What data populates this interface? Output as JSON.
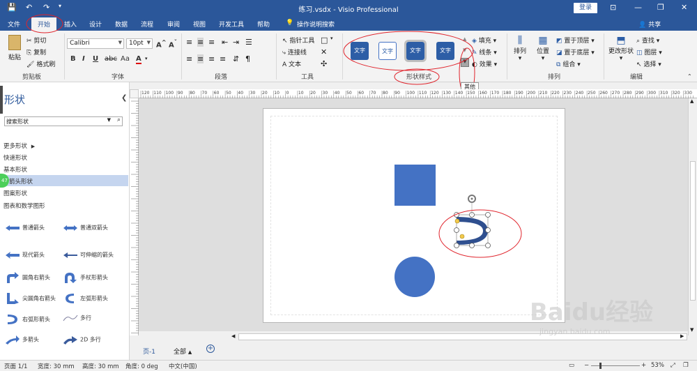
{
  "window": {
    "title": "练习.vsdx - Visio Professional",
    "login_label": "登录"
  },
  "tabs": [
    "文件",
    "开始",
    "插入",
    "设计",
    "数据",
    "流程",
    "审阅",
    "视图",
    "开发工具",
    "帮助",
    "操作说明搜索"
  ],
  "share_label": "共享",
  "ribbon": {
    "clipboard": {
      "paste": "粘贴",
      "cut": "剪切",
      "copy": "复制",
      "format_painter": "格式刷",
      "label": "剪贴板"
    },
    "font": {
      "name": "Calibri",
      "size": "10pt",
      "label": "字体"
    },
    "paragraph": {
      "label": "段落"
    },
    "tools": {
      "pointer": "指针工具",
      "connector": "连接线",
      "text": "文本",
      "label": "工具"
    },
    "shape_styles": {
      "items": [
        "文字",
        "文字",
        "文字",
        "文字"
      ],
      "label": "形状样式",
      "fill": "填充",
      "line": "线条",
      "effect": "效果"
    },
    "arrange": {
      "align": "排列",
      "position": "位置",
      "bring_front": "置于顶层",
      "send_back": "置于底层",
      "group": "组合",
      "label": "排列"
    },
    "editing": {
      "change_shape": "更改形状",
      "find": "查找",
      "layers": "图层",
      "select": "选择",
      "label": "编辑"
    }
  },
  "tooltip": "其他",
  "shapes_pane": {
    "title": "形状",
    "search_placeholder": "搜索形状",
    "stencils": [
      "更多形状",
      "快速形状",
      "基本形状",
      "箭头形状",
      "图案形状",
      "图表和数学图形"
    ],
    "badge": "47",
    "shapes": [
      "普通箭头",
      "普通双箭头",
      "现代箭头",
      "可伸缩的箭头",
      "圆角右箭头",
      "手杖形箭头",
      "尖圆角右箭头",
      "左弧形箭头",
      "右弧形箭头",
      "多行",
      "多箭头",
      "2D 多行"
    ]
  },
  "ruler_ticks": [
    "120",
    "110",
    "100",
    "90",
    "80",
    "70",
    "60",
    "50",
    "40",
    "30",
    "20",
    "10",
    "0",
    "10",
    "20",
    "30",
    "40",
    "50",
    "60",
    "70",
    "80",
    "90",
    "100",
    "110",
    "120",
    "130",
    "140",
    "150",
    "160",
    "170",
    "180",
    "190",
    "200",
    "210",
    "220",
    "230",
    "240",
    "250",
    "260",
    "270",
    "280",
    "290",
    "300",
    "310",
    "320",
    "330"
  ],
  "page_tabs": {
    "page": "页-1",
    "all": "全部"
  },
  "status": {
    "page": "页面 1/1",
    "width": "宽度: 30 mm",
    "height": "高度: 30 mm",
    "angle": "角度: 0 deg",
    "language": "中文(中国)",
    "zoom": "53%"
  },
  "colors": {
    "brand": "#2b579a",
    "shape_fill": "#4472c4",
    "annotation": "#e0242c"
  },
  "watermark": {
    "brand": "Baidu经验",
    "url": "jingyan.baidu.com"
  }
}
